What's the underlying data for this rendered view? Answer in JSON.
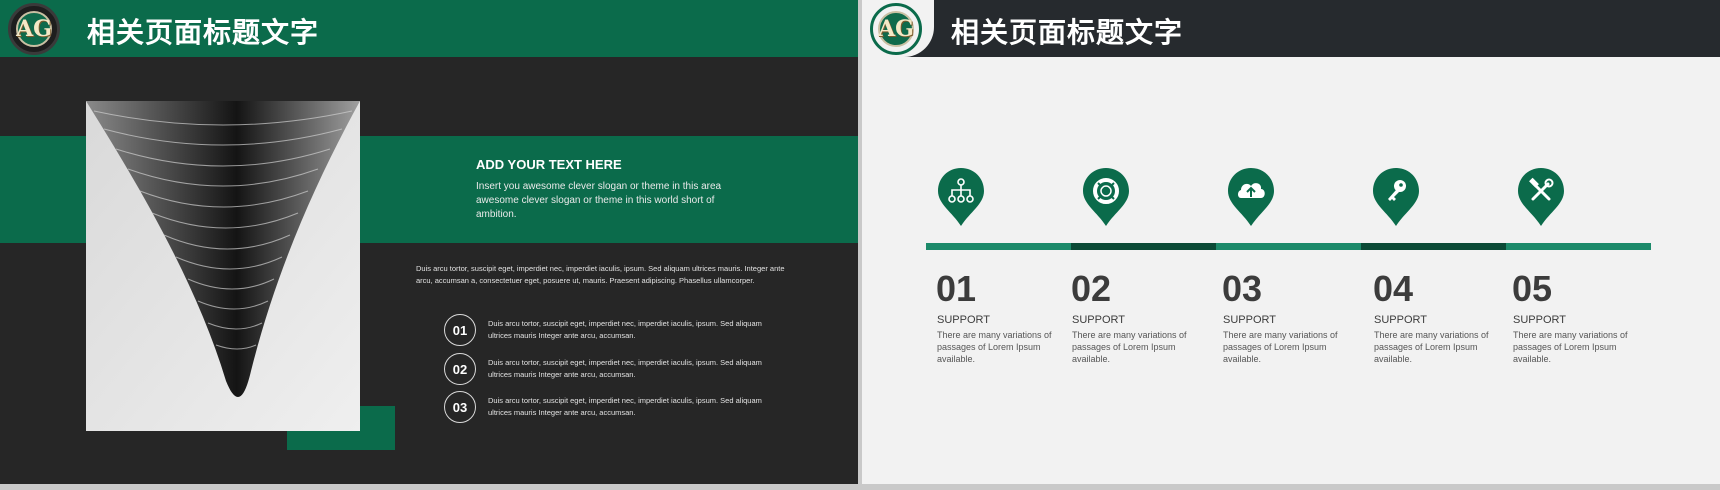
{
  "colors": {
    "accent": "#0b6b4b",
    "accent_light": "#1c8a6a",
    "dark": "#262626",
    "header_dark": "#262a2e",
    "light": "#f2f2f2"
  },
  "slide_left": {
    "title": "相关页面标题文字",
    "logo_letters": "AG",
    "photo_icon": "skyscraper-photo",
    "headline": "ADD YOUR TEXT HERE",
    "headline_body": "Insert you awesome clever slogan or theme in this area awesome clever slogan or theme in this world short of ambition.",
    "intro": "Duis arcu tortor, suscipit eget, imperdiet nec, imperdiet iaculis, ipsum. Sed aliquam ultrices mauris. Integer ante arcu, accumsan a, consectetuer eget, posuere ut, mauris. Praesent adipiscing. Phasellus ullamcorper.",
    "items": [
      {
        "num": "01",
        "text": "Duis arcu tortor, suscipit eget, imperdiet nec, imperdiet iaculis, ipsum. Sed aliquam ultrices mauris Integer ante arcu, accumsan."
      },
      {
        "num": "02",
        "text": "Duis arcu tortor, suscipit eget, imperdiet nec, imperdiet iaculis, ipsum. Sed aliquam ultrices mauris Integer ante arcu, accumsan."
      },
      {
        "num": "03",
        "text": "Duis arcu tortor, suscipit eget, imperdiet nec, imperdiet iaculis, ipsum. Sed aliquam ultrices mauris Integer ante arcu, accumsan."
      }
    ]
  },
  "slide_right": {
    "title": "相关页面标题文字",
    "logo_letters": "AG",
    "steps": [
      {
        "num": "01",
        "title": "SUPPORT",
        "desc": "There are many variations of passages of Lorem Ipsum available.",
        "icon": "hierarchy-icon"
      },
      {
        "num": "02",
        "title": "SUPPORT",
        "desc": "There are many variations of passages of Lorem Ipsum available.",
        "icon": "lifebuoy-icon"
      },
      {
        "num": "03",
        "title": "SUPPORT",
        "desc": "There are many variations of passages of Lorem Ipsum available.",
        "icon": "cloud-upload-icon"
      },
      {
        "num": "04",
        "title": "SUPPORT",
        "desc": "There are many variations of passages of Lorem Ipsum available.",
        "icon": "key-icon"
      },
      {
        "num": "05",
        "title": "SUPPORT",
        "desc": "There are many variations of passages of Lorem Ipsum available.",
        "icon": "tools-icon"
      }
    ]
  }
}
